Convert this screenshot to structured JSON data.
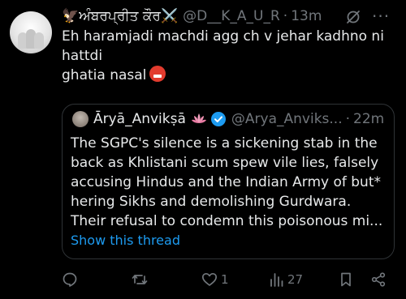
{
  "tweet": {
    "display_name": "🦅ਅੰਬਰਪ੍ਰੀਤ ਕੌਰ⚔️",
    "handle": "@D__K_A_U_R",
    "separator": "·",
    "time": "13m",
    "more_glyph": "···",
    "text_lines": [
      "Eh haramjadi machdi agg ch v jehar kadhno ni",
      "hattdi",
      "ghatia nasal"
    ]
  },
  "quote": {
    "display_name": "Āryā_Anvikṣā",
    "handle": "@Arya_Anviks...",
    "separator": "·",
    "time": "22m",
    "text_lines": [
      "The SGPC's silence is a sickening stab in the",
      "back as Khlistani scum spew vile lies, falsely",
      "accusing Hindus and the Indian Army of but*",
      "hering Sikhs and demolishing Gurdwara.",
      "Their refusal to condemn this poisonous mi..."
    ],
    "show_thread": "Show this thread"
  },
  "actions": {
    "reply_count": "",
    "retweet_count": "",
    "like_count": "1",
    "views_count": "27"
  },
  "colors": {
    "background": "#000000",
    "text": "#e7e9ea",
    "muted": "#71767b",
    "link": "#1d9bf0",
    "verified": "#1d9bf0",
    "border": "#2f3336"
  },
  "icons": [
    "grok-icon",
    "more-icon",
    "lotus-icon",
    "verified-badge-icon",
    "reply-icon",
    "retweet-icon",
    "like-icon",
    "views-icon",
    "bookmark-icon",
    "share-icon"
  ]
}
